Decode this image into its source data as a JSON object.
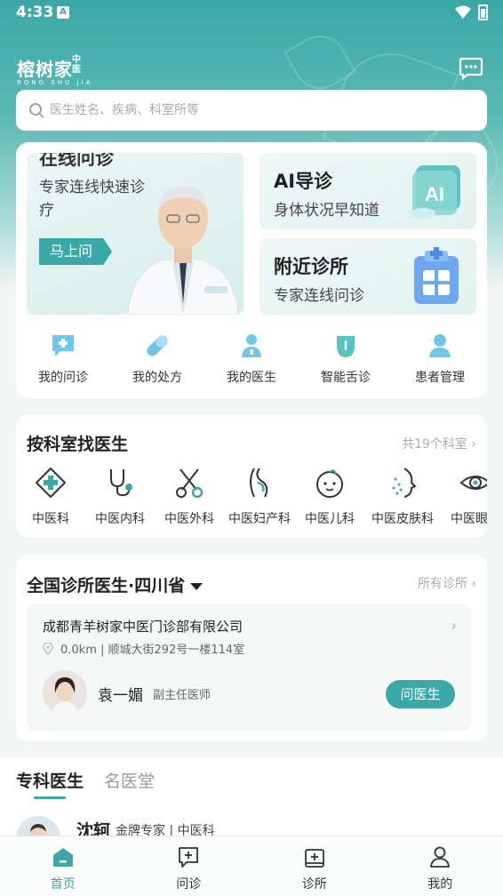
{
  "status_bar": {
    "time": "4:33",
    "notif_letter": "A"
  },
  "header": {
    "logo_cn": "榕树家",
    "logo_en": "RONG SHU JIA",
    "logo_tag": "中医"
  },
  "search": {
    "placeholder": "医生姓名、疾病、科室所等"
  },
  "promo": {
    "main": {
      "title": "在线问诊",
      "subtitle": "专家连线快速诊疗",
      "button": "马上问"
    },
    "ai": {
      "title": "AI导诊",
      "subtitle": "身体状况早知道"
    },
    "nearby": {
      "title": "附近诊所",
      "subtitle": "专家连线问诊"
    }
  },
  "quick_actions": [
    {
      "label": "我的问诊",
      "icon": "chat-plus-icon"
    },
    {
      "label": "我的处方",
      "icon": "pill-icon"
    },
    {
      "label": "我的医生",
      "icon": "doctor-icon"
    },
    {
      "label": "智能舌诊",
      "icon": "tongue-icon"
    },
    {
      "label": "患者管理",
      "icon": "patient-icon"
    }
  ],
  "departments": {
    "title": "按科室找医生",
    "more": "共19个科室",
    "items": [
      {
        "label": "中医科",
        "icon": "medical-cross-icon"
      },
      {
        "label": "中医内科",
        "icon": "stethoscope-icon"
      },
      {
        "label": "中医外科",
        "icon": "scissors-icon"
      },
      {
        "label": "中医妇产科",
        "icon": "pregnancy-icon"
      },
      {
        "label": "中医儿科",
        "icon": "baby-icon"
      },
      {
        "label": "中医皮肤科",
        "icon": "skin-icon"
      },
      {
        "label": "中医眼科",
        "icon": "eye-icon"
      }
    ]
  },
  "clinics": {
    "title": "全国诊所医生·四川省",
    "more": "所有诊所",
    "clinic_name": "成都青羊树家中医门诊部有限公司",
    "address": "0.0km | 顺城大街292号一楼114室",
    "doctor_name": "袁一媚",
    "doctor_title": "副主任医师",
    "ask_button": "问医生"
  },
  "tabs": {
    "active": "专科医生",
    "inactive": "名医堂"
  },
  "doctor_list": [
    {
      "name": "沈轲",
      "meta": "金牌专家 | 中医科"
    }
  ],
  "bottom_nav": [
    {
      "label": "首页",
      "icon": "home-icon",
      "active": true
    },
    {
      "label": "问诊",
      "icon": "consult-icon",
      "active": false
    },
    {
      "label": "诊所",
      "icon": "clinic-icon",
      "active": false
    },
    {
      "label": "我的",
      "icon": "profile-icon",
      "active": false
    }
  ],
  "colors": {
    "accent": "#3aa8a6",
    "bg": "#f4f6f6"
  }
}
